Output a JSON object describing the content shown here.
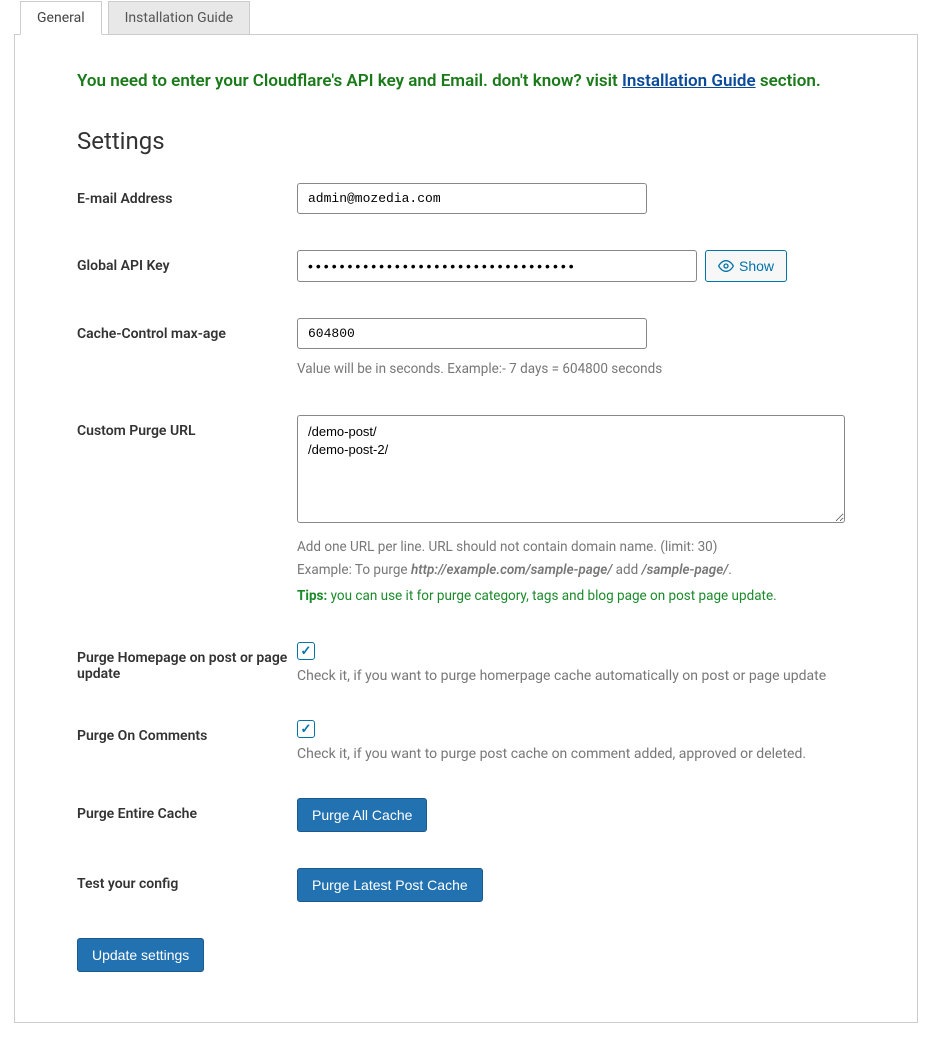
{
  "tabs": {
    "general": "General",
    "install_guide": "Installation Guide"
  },
  "notice": {
    "before": "You need to enter your Cloudflare's API key and Email. don't know? visit ",
    "link": "Installation Guide",
    "after": " section."
  },
  "heading": "Settings",
  "fields": {
    "email": {
      "label": "E-mail Address",
      "value": "admin@mozedia.com"
    },
    "api_key": {
      "label": "Global API Key",
      "value": "••••••••••••••••••••••••••••••••••",
      "show_btn": "Show"
    },
    "max_age": {
      "label": "Cache-Control max-age",
      "value": "604800",
      "hint": "Value will be in seconds. Example:- 7 days = 604800 seconds"
    },
    "purge_url": {
      "label": "Custom Purge URL",
      "value": "/demo-post/\n/demo-post-2/",
      "hint1": "Add one URL per line. URL should not contain domain name. (limit: 30)",
      "hint2a": "Example: To purge ",
      "hint2b": "http://example.com/sample-page/",
      "hint2c": " add ",
      "hint2d": "/sample-page/",
      "hint2e": ".",
      "tip_label": "Tips:",
      "tip_text": " you can use it for purge category, tags and blog page on post page update."
    },
    "purge_home": {
      "label": "Purge Homepage on post or page update",
      "hint": "Check it, if you want to purge homerpage cache automatically on post or page update"
    },
    "purge_comments": {
      "label": "Purge On Comments",
      "hint": "Check it, if you want to purge post cache on comment added, approved or deleted."
    },
    "purge_entire": {
      "label": "Purge Entire Cache",
      "button": "Purge All Cache"
    },
    "test_config": {
      "label": "Test your config",
      "button": "Purge Latest Post Cache"
    }
  },
  "submit": "Update settings"
}
